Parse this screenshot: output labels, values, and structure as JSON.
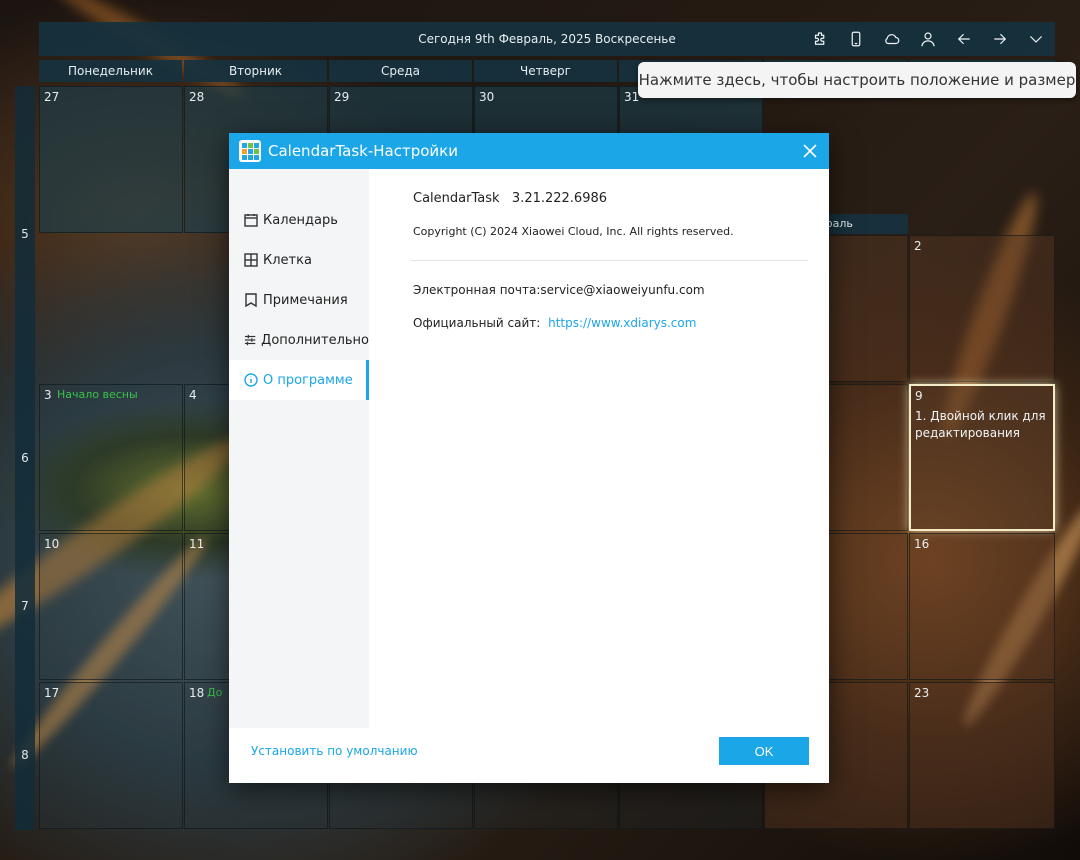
{
  "topbar": {
    "title": "Сегодня 9th Февраль, 2025 Воскресенье",
    "icons": [
      "puzzle-icon",
      "phone-icon",
      "cloud-icon",
      "user-icon",
      "arrow-left-icon",
      "arrow-right-icon",
      "chevron-down-icon"
    ]
  },
  "tooltip": "Нажмите здесь, чтобы настроить положение и размер",
  "calendar": {
    "weekdays": [
      "Понедельник",
      "Вторник",
      "Среда",
      "Четверг"
    ],
    "month_label": "враль",
    "weeks": [
      "5",
      "6",
      "7",
      "8"
    ],
    "days": {
      "r1": [
        "27",
        "28",
        "29",
        "30",
        "31"
      ],
      "r1_sun": "2",
      "r2_mon": "3",
      "r2_tue": "4",
      "r2_sun": "9",
      "r3_mon": "10",
      "r3_tue": "11",
      "r3_sun": "16",
      "r4_mon": "17",
      "r4_tue": "18",
      "r4_sun": "23"
    },
    "holiday_mar3": "Начало весны",
    "holiday_18": "До",
    "note_9": "1. Двойной клик для редактирования"
  },
  "dialog": {
    "title": "CalendarTask-Настройки",
    "sidebar": [
      {
        "label": "Календарь",
        "icon": "calendar-icon"
      },
      {
        "label": "Клетка",
        "icon": "grid-icon"
      },
      {
        "label": "Примечания",
        "icon": "bookmark-icon"
      },
      {
        "label": "Дополнительно",
        "icon": "sliders-icon"
      },
      {
        "label": "О программе",
        "icon": "info-icon"
      }
    ],
    "active_item": "О программе",
    "about": {
      "name": "CalendarTask   3.21.222.6986",
      "copyright": "Copyright (C) 2024 Xiaowei Cloud, Inc. All rights reserved.",
      "email": "Электронная почта:service@xiaoweiyunfu.com",
      "site_label": "Официальный сайт:",
      "site_url": "https://www.xdiarys.com"
    },
    "footer": {
      "reset": "Установить по умолчанию",
      "ok": "OK"
    }
  },
  "colors": {
    "accent": "#1ba6e8",
    "header_bg": "#15313e",
    "holiday": "#39c24a"
  }
}
